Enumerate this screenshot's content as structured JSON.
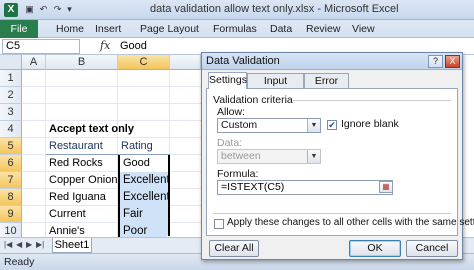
{
  "window": {
    "title": "data validation allow text only.xlsx - Microsoft Excel"
  },
  "ribbon": {
    "tabs": [
      "File",
      "Home",
      "Insert",
      "Page Layout",
      "Formulas",
      "Data",
      "Review",
      "View"
    ]
  },
  "formula_bar": {
    "name_box": "C5",
    "fx": "fx",
    "value": "Good"
  },
  "grid": {
    "columns": [
      "A",
      "B",
      "C"
    ],
    "rows": [
      "1",
      "2",
      "3",
      "4",
      "5",
      "6",
      "7",
      "8",
      "9",
      "10"
    ],
    "title": "Accept text only",
    "header_restaurant": "Restaurant",
    "header_rating": "Rating",
    "data": [
      {
        "restaurant": "Red Rocks",
        "rating": "Good"
      },
      {
        "restaurant": "Copper Onion",
        "rating": "Excellent"
      },
      {
        "restaurant": "Red Iguana",
        "rating": "Excellent"
      },
      {
        "restaurant": "Current",
        "rating": "Fair"
      },
      {
        "restaurant": "Annie's",
        "rating": "Poor"
      }
    ]
  },
  "sheet": {
    "tab": "Sheet1"
  },
  "status": {
    "text": "Ready"
  },
  "dialog": {
    "title": "Data Validation",
    "help": "?",
    "close": "X",
    "tabs": [
      "Settings",
      "Input Message",
      "Error Alert"
    ],
    "criteria_label": "Validation criteria",
    "allow_label": "Allow:",
    "allow_value": "Custom",
    "ignore_blank_label": "Ignore blank",
    "ignore_blank_checked": true,
    "data_label": "Data:",
    "data_value": "between",
    "formula_label": "Formula:",
    "formula_value": "=ISTEXT(C5)",
    "apply_label": "Apply these changes to all other cells with the same settings",
    "apply_checked": false,
    "clear_all": "Clear All",
    "ok": "OK",
    "cancel": "Cancel"
  }
}
